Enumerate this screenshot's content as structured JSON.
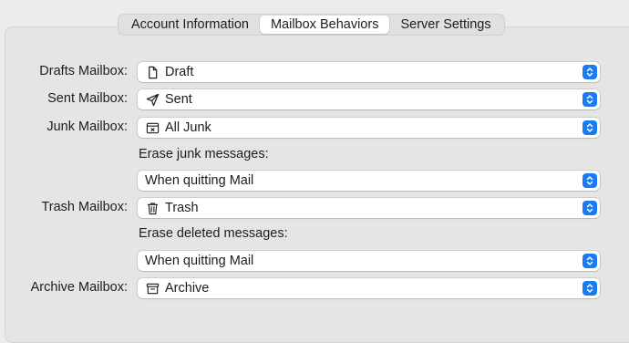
{
  "tabs": [
    "Account Information",
    "Mailbox Behaviors",
    "Server Settings"
  ],
  "active_tab_index": 1,
  "rows": {
    "drafts": {
      "label": "Drafts Mailbox:",
      "value": "Draft",
      "icon": "document-icon"
    },
    "sent": {
      "label": "Sent Mailbox:",
      "value": "Sent",
      "icon": "paper-plane-icon"
    },
    "junk": {
      "label": "Junk Mailbox:",
      "value": "All Junk",
      "icon": "junk-tray-icon"
    },
    "erase_junk": {
      "label": "Erase junk messages:",
      "value": "When quitting Mail"
    },
    "trash": {
      "label": "Trash Mailbox:",
      "value": "Trash",
      "icon": "trash-icon"
    },
    "erase_deleted": {
      "label": "Erase deleted messages:",
      "value": "When quitting Mail"
    },
    "archive": {
      "label": "Archive Mailbox:",
      "value": "Archive",
      "icon": "archive-box-icon"
    }
  },
  "colors": {
    "accent": "#1a7cf5",
    "background": "#ececec",
    "control": "#ffffff"
  }
}
